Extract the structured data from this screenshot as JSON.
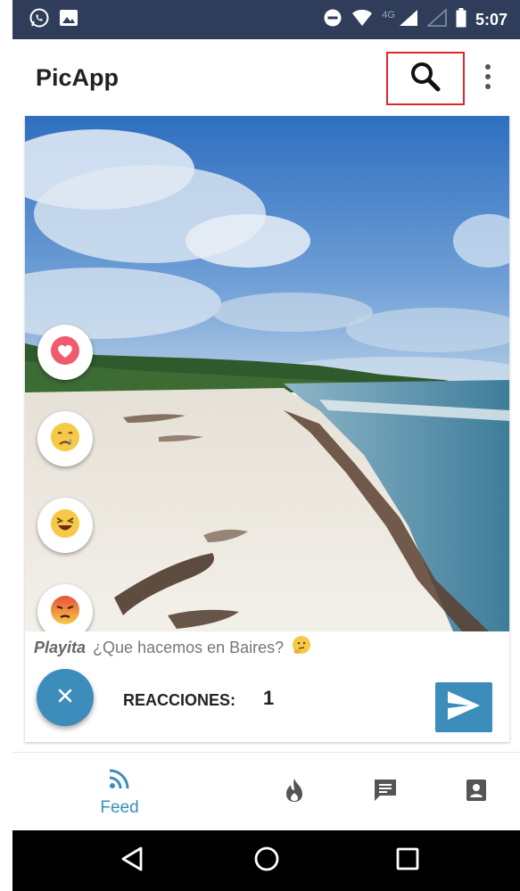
{
  "status_bar": {
    "network": "4G",
    "time": "5:07"
  },
  "app_bar": {
    "title": "PicApp",
    "search_icon": "search-icon",
    "more_icon": "more-vert-icon"
  },
  "post": {
    "photo_icon": "beach-photo",
    "reactions": [
      {
        "name": "heart-reaction",
        "icon": "heart-icon"
      },
      {
        "name": "crying-reaction",
        "icon": "crying-face-icon"
      },
      {
        "name": "laughing-reaction",
        "icon": "laughing-face-icon"
      },
      {
        "name": "angry-reaction",
        "icon": "angry-face-icon"
      }
    ],
    "user": "Playita",
    "caption": "¿Que hacemos en Baires?",
    "reactions_label": "REACCIONES:",
    "reactions_count": "1"
  },
  "bottom_nav": {
    "feed_label": "Feed",
    "items": [
      "rss-icon",
      "flame-icon",
      "chat-icon",
      "contact-icon"
    ]
  },
  "colors": {
    "status_bar": "#2f3d5a",
    "accent": "#3c8dbc",
    "highlight_border": "#e0262a"
  }
}
